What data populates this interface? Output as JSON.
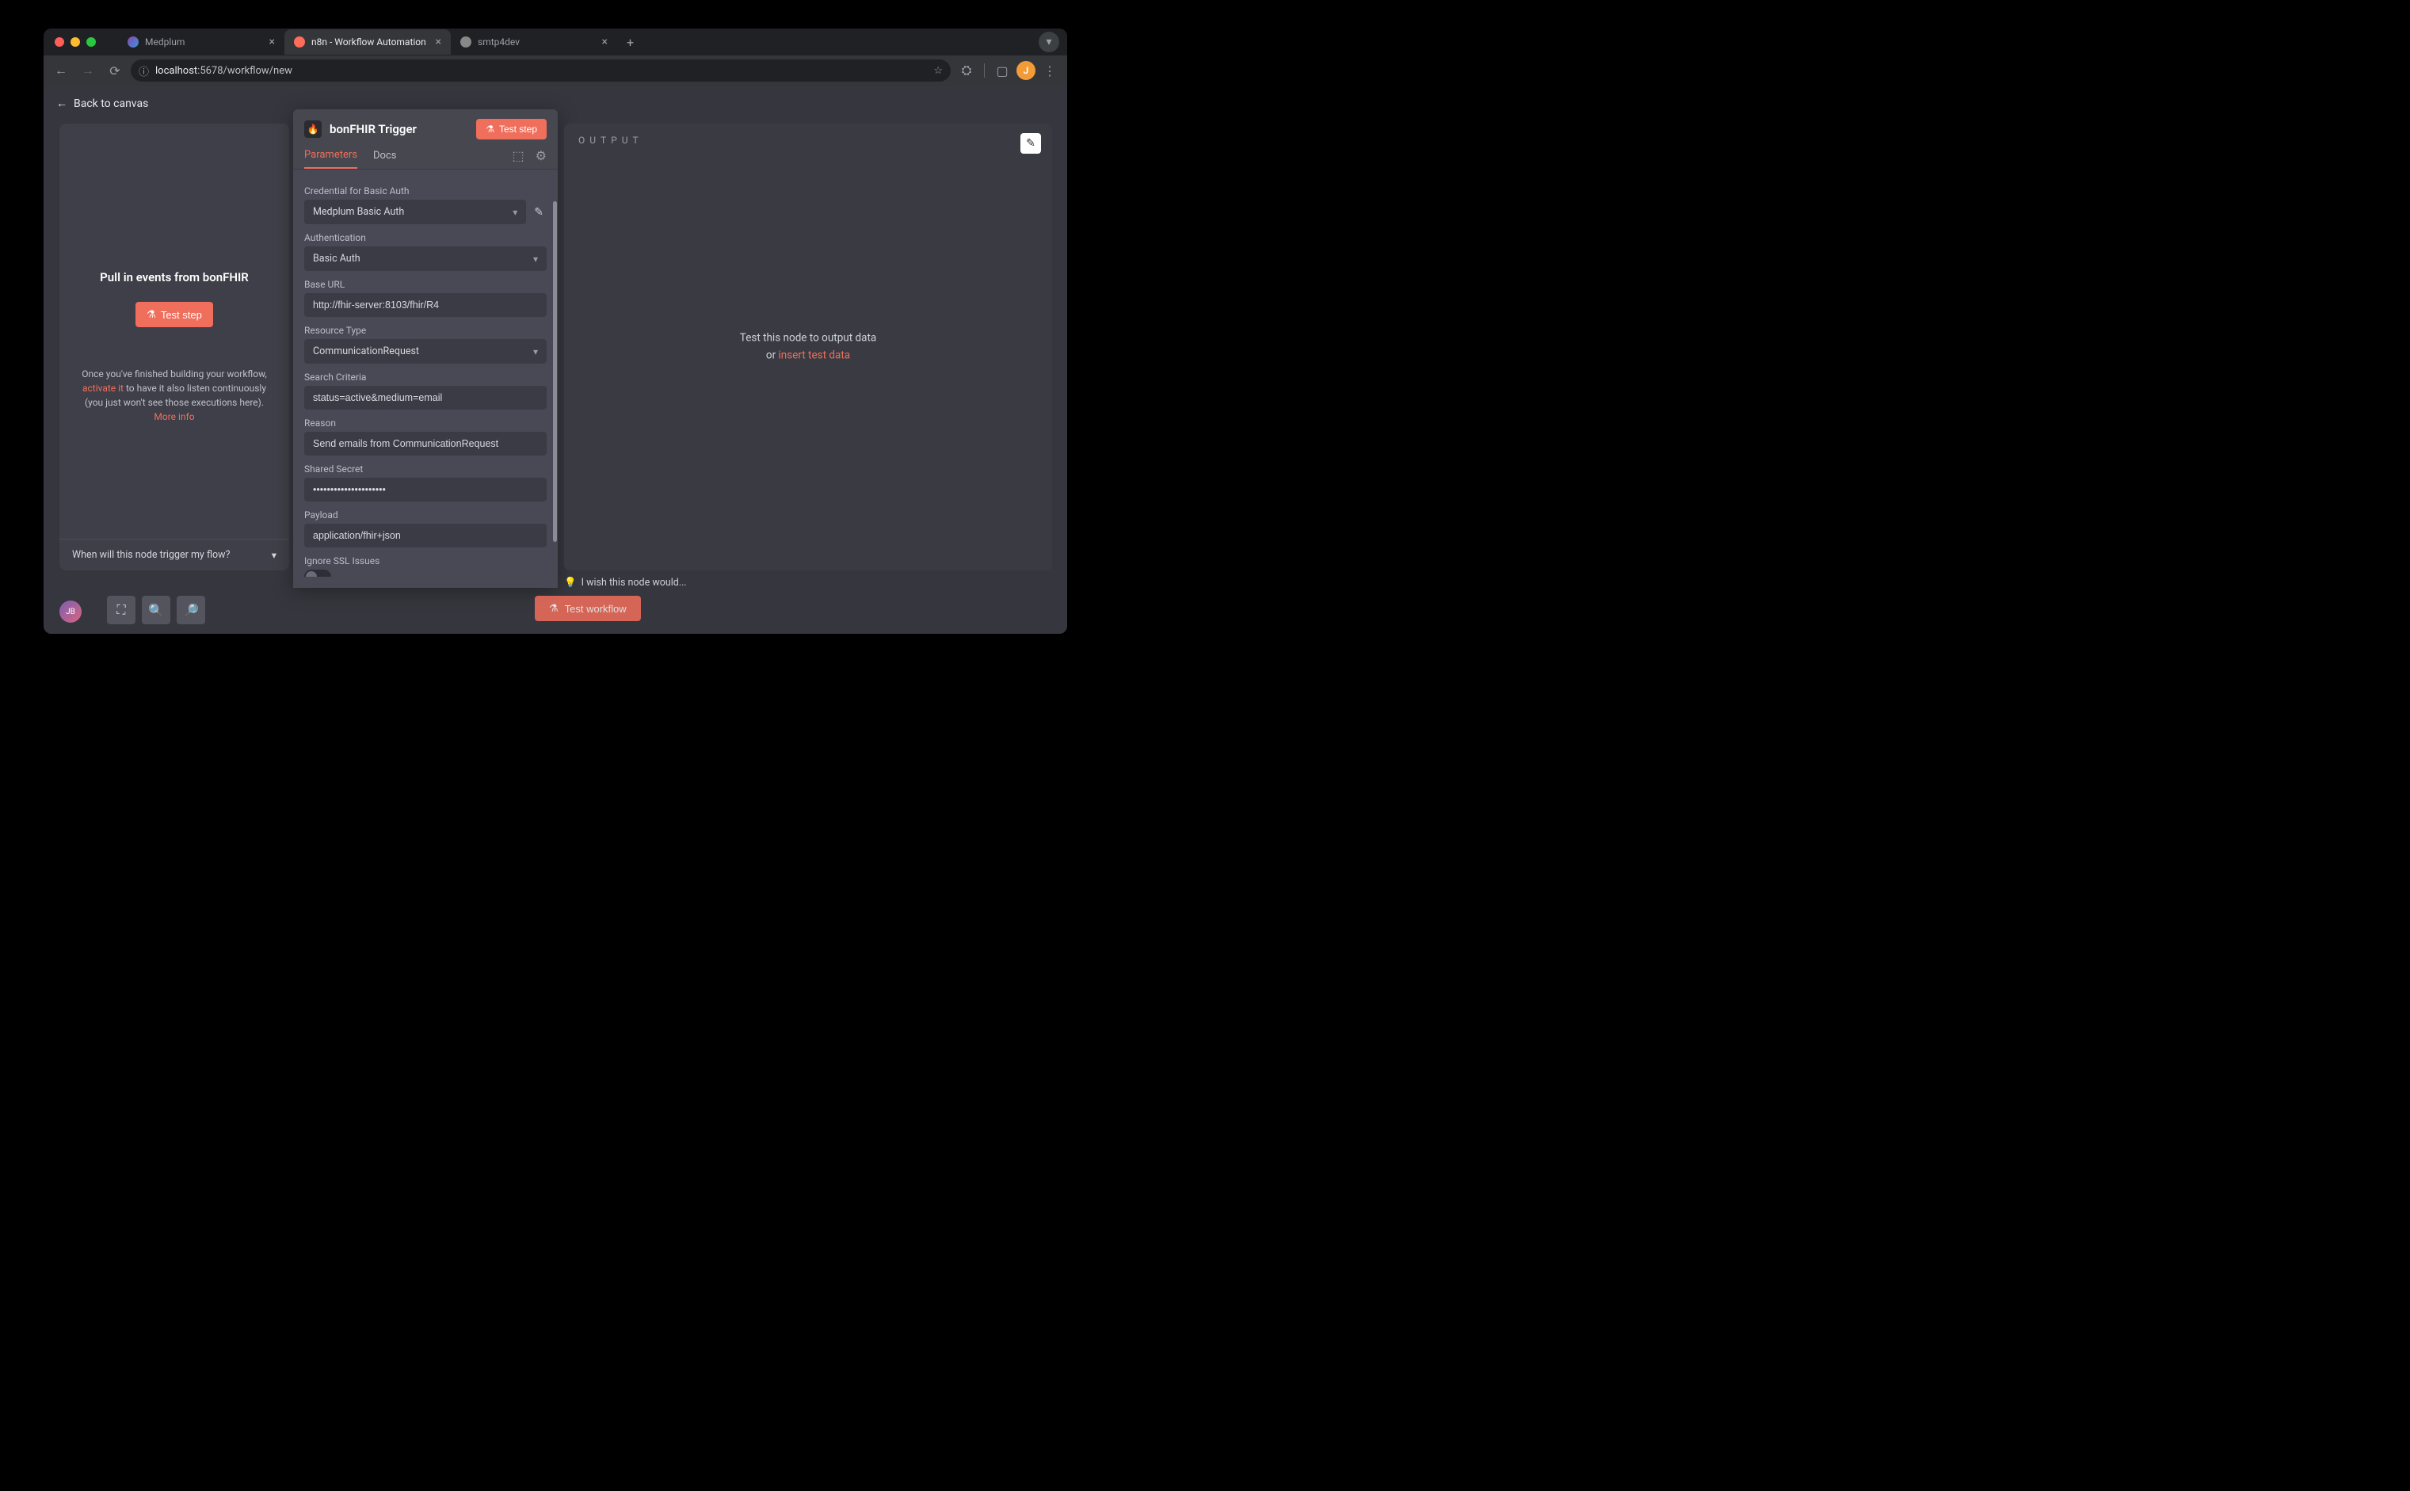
{
  "browser": {
    "tabs": [
      {
        "title": "Medplum"
      },
      {
        "title": "n8n - Workflow Automation"
      },
      {
        "title": "smtp4dev"
      }
    ],
    "url_display": {
      "host": "localhost",
      "port_path": ":5678/workflow/new"
    },
    "avatar_letter": "J"
  },
  "app": {
    "back": "Back to canvas",
    "input_panel": {
      "title": "Pull in events from bonFHIR",
      "test": "Test step",
      "hint_pre": "Once you've finished building your workflow, ",
      "hint_activate": "activate it",
      "hint_mid": " to have it also listen continuously (you just won't see those executions here).  ",
      "hint_more": "More info",
      "footer": "When will this node trigger my flow?"
    },
    "config": {
      "title": "bonFHIR Trigger",
      "test_step": "Test step",
      "tabs": {
        "params": "Parameters",
        "docs": "Docs"
      },
      "fields": {
        "credential_label": "Credential for Basic Auth",
        "credential_value": "Medplum Basic Auth",
        "auth_label": "Authentication",
        "auth_value": "Basic Auth",
        "baseurl_label": "Base URL",
        "baseurl_value": "http://fhir-server:8103/fhir/R4",
        "resource_label": "Resource Type",
        "resource_value": "CommunicationRequest",
        "search_label": "Search Criteria",
        "search_value": "status=active&medium=email",
        "reason_label": "Reason",
        "reason_value": "Send emails from CommunicationRequest",
        "secret_label": "Shared Secret",
        "secret_value": "•••••••••••••••••••••",
        "payload_label": "Payload",
        "payload_value": "application/fhir+json",
        "ssl_label": "Ignore SSL Issues"
      }
    },
    "output": {
      "header": "OUTPUT",
      "msg_line1": "Test this node to output data",
      "msg_line2a": "or ",
      "msg_line2b": "insert test data"
    },
    "feedback": "I wish this node would...",
    "test_workflow": "Test workflow",
    "user_bubble": "JB"
  }
}
